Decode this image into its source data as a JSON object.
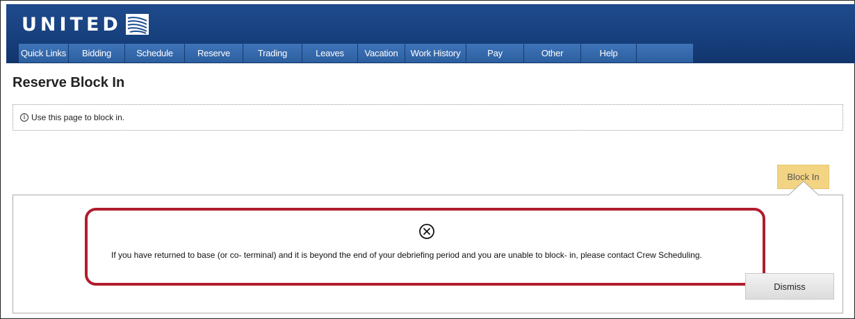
{
  "brand": {
    "name": "UNITED",
    "globe_icon": "united-globe-icon"
  },
  "nav": {
    "items": [
      {
        "label": "Quick Links",
        "width": 72
      },
      {
        "label": "Bidding",
        "width": 81
      },
      {
        "label": "Schedule",
        "width": 86
      },
      {
        "label": "Reserve",
        "width": 84
      },
      {
        "label": "Trading",
        "width": 85
      },
      {
        "label": "Leaves",
        "width": 80
      },
      {
        "label": "Vacation",
        "width": 68
      },
      {
        "label": "Work History",
        "width": 88
      },
      {
        "label": "Pay",
        "width": 83
      },
      {
        "label": "Other",
        "width": 82
      },
      {
        "label": "Help",
        "width": 80
      }
    ]
  },
  "page": {
    "title": "Reserve Block In",
    "info_text": "Use this page to block in.",
    "info_icon": "info-icon"
  },
  "actions": {
    "block_in_label": "Block In",
    "dismiss_label": "Dismiss"
  },
  "alert": {
    "icon": "error-circle-x-icon",
    "message": "If you have returned to base (or co- terminal) and it is beyond the end of your debriefing period and you are unable to block- in, please contact Crew Scheduling.",
    "highlight_color": "#b01c2e"
  },
  "colors": {
    "header_blue": "#17407e",
    "nav_blue": "#3368ad",
    "block_in_yellow": "#f3d483"
  }
}
